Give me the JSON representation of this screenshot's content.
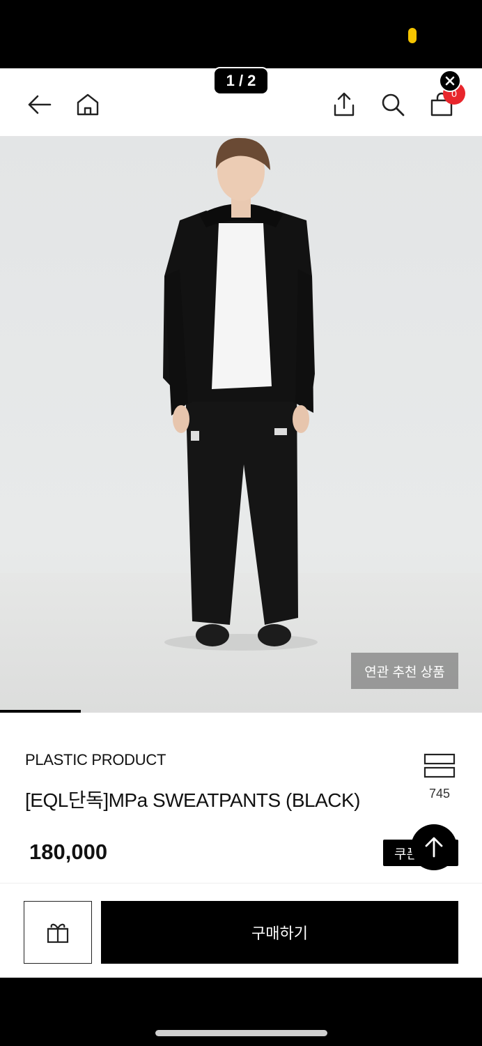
{
  "gallery": {
    "page_indicator": "1 / 2",
    "related_label": "연관 추천 상품",
    "progress": 0.167
  },
  "header": {
    "cart_count": "0"
  },
  "product": {
    "brand": "PLASTIC PRODUCT",
    "name": "[EQL단독]MPa SWEATPANTS (BLACK)",
    "price": "180,000",
    "view_count": "745",
    "coupon_label": "쿠폰"
  },
  "actions": {
    "buy_label": "구매하기"
  },
  "icons": {
    "back": "arrow-left-icon",
    "home": "home-icon",
    "share": "share-icon",
    "search": "search-icon",
    "cart": "shopping-bag-icon",
    "close": "close-icon",
    "view": "view-toggle-icon",
    "gift": "gift-icon",
    "top": "arrow-up-icon"
  },
  "colors": {
    "accent": "#000000",
    "badge": "#e8262c",
    "status_dot": "#f5c400"
  }
}
